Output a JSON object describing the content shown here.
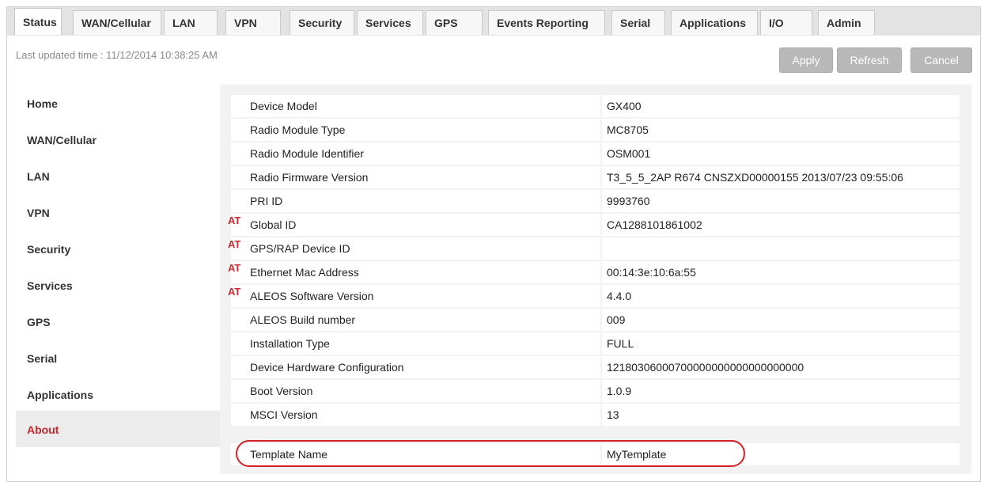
{
  "tabs": [
    {
      "label": "Status",
      "active": true
    },
    {
      "label": "WAN/Cellular"
    },
    {
      "label": "LAN"
    },
    {
      "label": "VPN"
    },
    {
      "label": "Security"
    },
    {
      "label": "Services"
    },
    {
      "label": "GPS"
    },
    {
      "label": "Events Reporting"
    },
    {
      "label": "Serial"
    },
    {
      "label": "Applications"
    },
    {
      "label": "I/O"
    },
    {
      "label": "Admin"
    }
  ],
  "header": {
    "last_updated": "Last updated time : 11/12/2014 10:38:25 AM",
    "apply_label": "Apply",
    "refresh_label": "Refresh",
    "cancel_label": "Cancel"
  },
  "sidebar": {
    "items": [
      {
        "label": "Home"
      },
      {
        "label": "WAN/Cellular"
      },
      {
        "label": "LAN"
      },
      {
        "label": "VPN"
      },
      {
        "label": "Security"
      },
      {
        "label": "Services"
      },
      {
        "label": "GPS"
      },
      {
        "label": "Serial"
      },
      {
        "label": "Applications"
      },
      {
        "label": "About",
        "active": true
      }
    ]
  },
  "about": {
    "at_marker": "AT",
    "rows": [
      {
        "label": "Device Model",
        "value": "GX400"
      },
      {
        "label": "Radio Module Type",
        "value": "MC8705"
      },
      {
        "label": "Radio Module Identifier",
        "value": "OSM001"
      },
      {
        "label": "Radio Firmware Version",
        "value": "T3_5_5_2AP R674 CNSZXD00000155 2013/07/23 09:55:06"
      },
      {
        "label": "PRI ID",
        "value": "9993760"
      },
      {
        "label": "Global ID",
        "value": "CA1288101861002",
        "at": true
      },
      {
        "label": "GPS/RAP Device ID",
        "value": "",
        "at": true
      },
      {
        "label": "Ethernet Mac Address",
        "value": "00:14:3e:10:6a:55",
        "at": true
      },
      {
        "label": "ALEOS Software Version",
        "value": "4.4.0",
        "at": true
      },
      {
        "label": "ALEOS Build number",
        "value": "009"
      },
      {
        "label": "Installation Type",
        "value": "FULL"
      },
      {
        "label": "Device Hardware Configuration",
        "value": "12180306000700000000000000000000"
      },
      {
        "label": "Boot Version",
        "value": "1.0.9"
      },
      {
        "label": "MSCI Version",
        "value": "13"
      },
      {
        "label": "Template Name",
        "value": "MyTemplate"
      }
    ]
  },
  "colors": {
    "accent_red": "#d42027",
    "button_gray": "#b8b8b8",
    "panel_bg": "#f2f2f2"
  }
}
